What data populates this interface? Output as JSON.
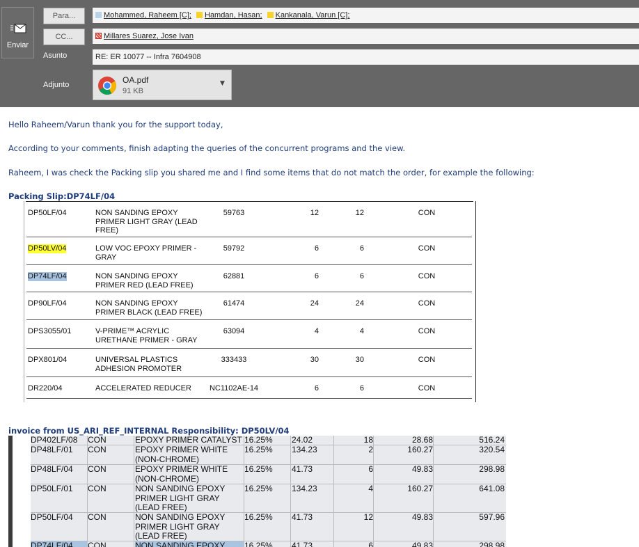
{
  "compose": {
    "send_label": "Enviar",
    "to_button": "Para...",
    "cc_button": "CC...",
    "subject_label": "Asunto",
    "attachment_label": "Adjunto",
    "to_recipients": [
      {
        "name": "Mohammed, Raheem [C];",
        "color": "#b9d4ea"
      },
      {
        "name": "Hamdan, Hasan;",
        "color": "#f6d32b"
      },
      {
        "name": "Kankanala, Varun [C];",
        "color": "#f6d32b"
      }
    ],
    "cc_recipients": [
      {
        "name": "Millares Suarez, Jose Ivan",
        "color": "#e24a3b"
      }
    ],
    "subject": "RE: ER 10077 -- Infra 7604908",
    "attachment": {
      "name": "OA.pdf",
      "size": "91 KB",
      "icon": "chrome-icon"
    }
  },
  "body": {
    "greeting": "Hello Raheem/Varun thank you for the support today,",
    "paragraph1": "According to your comments, finish adapting the queries of the concurrent programs and the view.",
    "paragraph2": "Raheem, I was check the Packing slip you shared me and I find some items that do not match the order, for example the following:",
    "packing_heading": "Packing Slip:DP74LF/04",
    "packing_rows": [
      {
        "code": "DP50LF/04",
        "desc": "NON SANDING EPOXY PRIMER LIGHT GRAY (LEAD FREE)",
        "num": "59763",
        "q1": "12",
        "q2": "12",
        "um": "CON"
      },
      {
        "code": "DP50LV/04",
        "desc": "LOW VOC EPOXY PRIMER - GRAY",
        "num": "59792",
        "q1": "6",
        "q2": "6",
        "um": "CON",
        "highlight": "yellow"
      },
      {
        "code": "DP74LF/04",
        "desc": "NON SANDING EPOXY PRIMER RED (LEAD FREE)",
        "num": "62881",
        "q1": "6",
        "q2": "6",
        "um": "CON",
        "highlight": "blue"
      },
      {
        "code": "DP90LF/04",
        "desc": "NON SANDING EPOXY PRIMER BLACK (LEAD FREE)",
        "num": "61474",
        "q1": "24",
        "q2": "24",
        "um": "CON"
      },
      {
        "code": "DPS3055/01",
        "desc": "V-PRIME™ ACRYLIC URETHANE PRIMER - GRAY",
        "num": "63094",
        "q1": "4",
        "q2": "4",
        "um": "CON"
      },
      {
        "code": "DPX801/04",
        "desc": "UNIVERSAL PLASTICS ADHESION PROMOTER",
        "num": "333433",
        "q1": "30",
        "q2": "30",
        "um": "CON"
      },
      {
        "code": "DR220/04",
        "desc": "ACCELERATED REDUCER",
        "num": "NC1102AE-14",
        "q1": "6",
        "q2": "6",
        "um": "CON"
      }
    ],
    "invoice_heading": "invoice from US_ARI_REF_INTERNAL Responsibility: DP50LV/04",
    "invoice_rows": [
      {
        "code": "DP402LF/08",
        "um": "CON",
        "desc": "EPOXY PRIMER CATALYST",
        "pct": "16.25%",
        "price": "24.02",
        "qty": "18",
        "unit": "28.68",
        "total": "516.24"
      },
      {
        "code": "DP48LF/01",
        "um": "CON",
        "desc": "EPOXY PRIMER WHITE (NON-CHROME)",
        "pct": "16.25%",
        "price": "134.23",
        "qty": "2",
        "unit": "160.27",
        "total": "320.54"
      },
      {
        "code": "DP48LF/04",
        "um": "CON",
        "desc": "EPOXY PRIMER WHITE (NON-CHROME)",
        "pct": "16.25%",
        "price": "41.73",
        "qty": "6",
        "unit": "49.83",
        "total": "298.98"
      },
      {
        "code": "DP50LF/01",
        "um": "CON",
        "desc": "NON SANDING EPOXY PRIMER LIGHT GRAY (LEAD FREE)",
        "pct": "16.25%",
        "price": "134.23",
        "qty": "4",
        "unit": "160.27",
        "total": "641.08"
      },
      {
        "code": "DP50LF/04",
        "um": "CON",
        "desc": "NON SANDING EPOXY PRIMER LIGHT GRAY (LEAD FREE)",
        "pct": "16.25%",
        "price": "41.73",
        "qty": "12",
        "unit": "49.83",
        "total": "597.96"
      },
      {
        "code": "DP74LF/04",
        "um": "CON",
        "desc": "NON SANDING EPOXY",
        "pct": "16.25%",
        "price": "41.73",
        "qty": "6",
        "unit": "49.83",
        "total": "298.98",
        "highlight": "blue"
      }
    ]
  }
}
